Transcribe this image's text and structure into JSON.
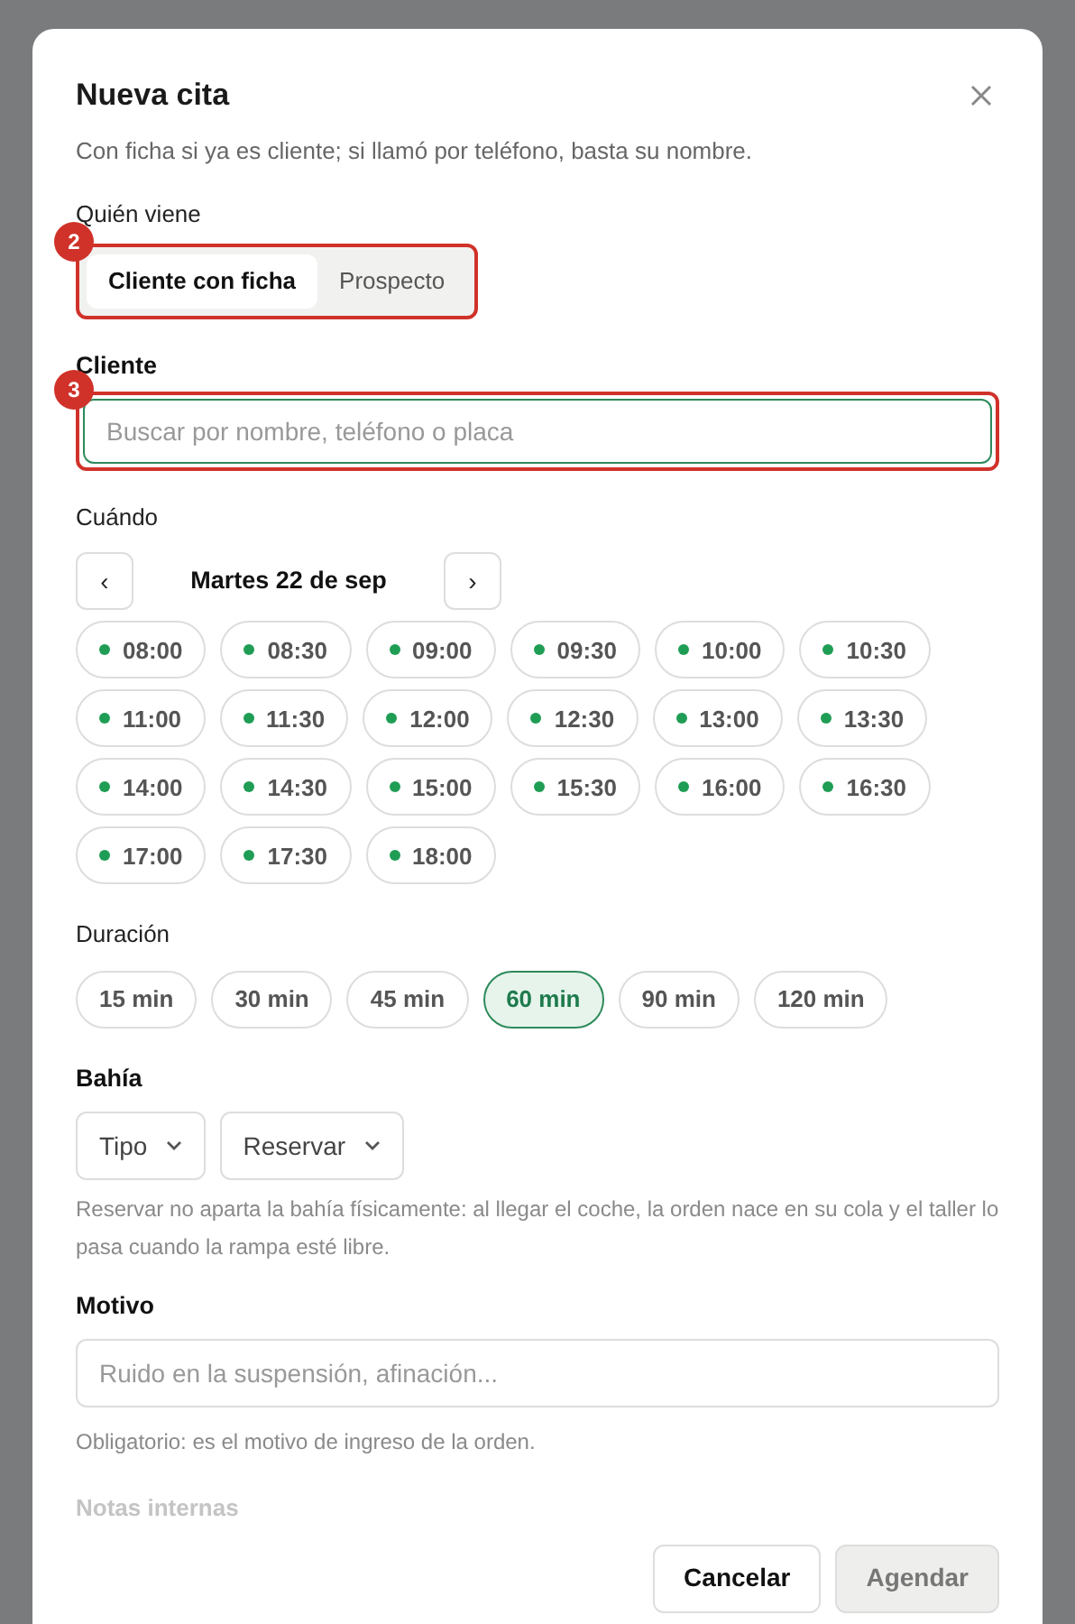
{
  "dialog": {
    "title": "Nueva cita",
    "subtitle": "Con ficha si ya es cliente; si llamó por teléfono, basta su nombre.",
    "who": {
      "label": "Quién viene",
      "marker": "2",
      "options": [
        {
          "label": "Cliente con ficha",
          "selected": true
        },
        {
          "label": "Prospecto",
          "selected": false
        }
      ]
    },
    "client": {
      "label": "Cliente",
      "marker": "3",
      "placeholder": "Buscar por nombre, teléfono o placa"
    },
    "when": {
      "label": "Cuándo",
      "prev": "‹",
      "date": "Martes 22 de sep",
      "next": "›",
      "slots": [
        {
          "time": "08:00",
          "available": true
        },
        {
          "time": "08:30",
          "available": true
        },
        {
          "time": "09:00",
          "available": true
        },
        {
          "time": "09:30",
          "available": true
        },
        {
          "time": "10:00",
          "available": true
        },
        {
          "time": "10:30",
          "available": true
        },
        {
          "time": "11:00",
          "available": true
        },
        {
          "time": "11:30",
          "available": true
        },
        {
          "time": "12:00",
          "available": true
        },
        {
          "time": "12:30",
          "available": true
        },
        {
          "time": "13:00",
          "available": true
        },
        {
          "time": "13:30",
          "available": true
        },
        {
          "time": "14:00",
          "available": true
        },
        {
          "time": "14:30",
          "available": true
        },
        {
          "time": "15:00",
          "available": true
        },
        {
          "time": "15:30",
          "available": true
        },
        {
          "time": "16:00",
          "available": true
        },
        {
          "time": "16:30",
          "available": true
        },
        {
          "time": "17:00",
          "available": true
        },
        {
          "time": "17:30",
          "available": true
        },
        {
          "time": "18:00",
          "available": true
        }
      ]
    },
    "duration": {
      "label": "Duración",
      "options": [
        {
          "label": "15 min",
          "selected": false
        },
        {
          "label": "30 min",
          "selected": false
        },
        {
          "label": "45 min",
          "selected": false
        },
        {
          "label": "60 min",
          "selected": true
        },
        {
          "label": "90 min",
          "selected": false
        },
        {
          "label": "120 min",
          "selected": false
        }
      ]
    },
    "bay": {
      "label": "Bahía",
      "selects": [
        "Tipo",
        "Reservar"
      ],
      "hint": "Reservar no aparta la bahía físicamente: al llegar el coche, la orden nace en su cola y el taller lo pasa cuando la rampa esté libre."
    },
    "reason": {
      "label": "Motivo",
      "placeholder": "Ruido en la suspensión, afinación...",
      "hint": "Obligatorio: es el motivo de ingreso de la orden."
    },
    "notes": {
      "label": "Notas internas"
    },
    "buttons": [
      {
        "label": "Cancelar",
        "kind": "secondary"
      },
      {
        "label": "Agendar",
        "kind": "primary",
        "disabled": true
      }
    ]
  }
}
